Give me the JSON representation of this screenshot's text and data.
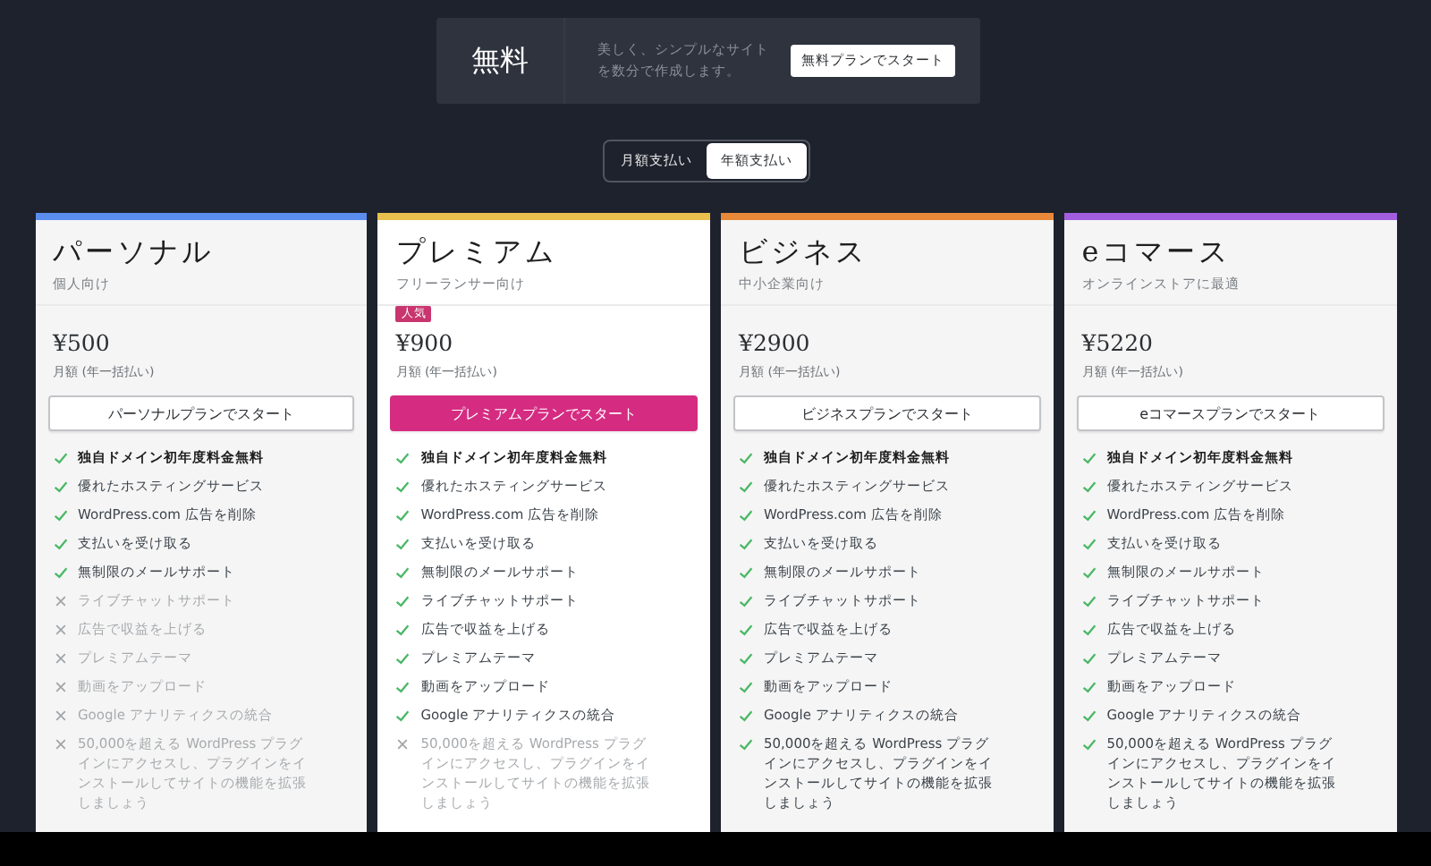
{
  "free_plan": {
    "title": "無料",
    "description": "美しく、シンプルなサイトを数分で作成します。",
    "button": "無料プランでスタート"
  },
  "billing_toggle": [
    {
      "label": "月額支払い",
      "selected": false
    },
    {
      "label": "年額支払い",
      "selected": true
    }
  ],
  "plans": [
    {
      "name": "パーソナル",
      "audience": "個人向け",
      "color": "#5b8def",
      "price": "¥500",
      "price_note": "月額 (年一括払い)",
      "button": "パーソナルプランでスタート",
      "highlighted": false,
      "features": [
        {
          "text": "独自ドメイン初年度料金無料",
          "included": true,
          "bold": true
        },
        {
          "text": "優れたホスティングサービス",
          "included": true,
          "bold": false
        },
        {
          "text": "WordPress.com 広告を削除",
          "included": true,
          "bold": false
        },
        {
          "text": "支払いを受け取る",
          "included": true,
          "bold": false
        },
        {
          "text": "無制限のメールサポート",
          "included": true,
          "bold": false
        },
        {
          "text": "ライブチャットサポート",
          "included": false,
          "bold": false
        },
        {
          "text": "広告で収益を上げる",
          "included": false,
          "bold": false
        },
        {
          "text": "プレミアムテーマ",
          "included": false,
          "bold": false
        },
        {
          "text": "動画をアップロード",
          "included": false,
          "bold": false
        },
        {
          "text": "Google アナリティクスの統合",
          "included": false,
          "bold": false
        },
        {
          "text": "50,000を超える WordPress プラグインにアクセスし、プラグインをインストールしてサイトの機能を拡張しましょう",
          "included": false,
          "bold": false
        }
      ]
    },
    {
      "name": "プレミアム",
      "audience": "フリーランサー向け",
      "badge": "人気",
      "color": "#e9c04d",
      "price": "¥900",
      "price_note": "月額 (年一括払い)",
      "button": "プレミアムプランでスタート",
      "highlighted": true,
      "features": [
        {
          "text": "独自ドメイン初年度料金無料",
          "included": true,
          "bold": true
        },
        {
          "text": "優れたホスティングサービス",
          "included": true,
          "bold": false
        },
        {
          "text": "WordPress.com 広告を削除",
          "included": true,
          "bold": false
        },
        {
          "text": "支払いを受け取る",
          "included": true,
          "bold": false
        },
        {
          "text": "無制限のメールサポート",
          "included": true,
          "bold": false
        },
        {
          "text": "ライブチャットサポート",
          "included": true,
          "bold": false
        },
        {
          "text": "広告で収益を上げる",
          "included": true,
          "bold": false
        },
        {
          "text": "プレミアムテーマ",
          "included": true,
          "bold": false
        },
        {
          "text": "動画をアップロード",
          "included": true,
          "bold": false
        },
        {
          "text": "Google アナリティクスの統合",
          "included": true,
          "bold": false
        },
        {
          "text": "50,000を超える WordPress プラグインにアクセスし、プラグインをインストールしてサイトの機能を拡張しましょう",
          "included": false,
          "bold": false
        }
      ]
    },
    {
      "name": "ビジネス",
      "audience": "中小企業向け",
      "color": "#e8893a",
      "price": "¥2900",
      "price_note": "月額 (年一括払い)",
      "button": "ビジネスプランでスタート",
      "highlighted": false,
      "features": [
        {
          "text": "独自ドメイン初年度料金無料",
          "included": true,
          "bold": true
        },
        {
          "text": "優れたホスティングサービス",
          "included": true,
          "bold": false
        },
        {
          "text": "WordPress.com 広告を削除",
          "included": true,
          "bold": false
        },
        {
          "text": "支払いを受け取る",
          "included": true,
          "bold": false
        },
        {
          "text": "無制限のメールサポート",
          "included": true,
          "bold": false
        },
        {
          "text": "ライブチャットサポート",
          "included": true,
          "bold": false
        },
        {
          "text": "広告で収益を上げる",
          "included": true,
          "bold": false
        },
        {
          "text": "プレミアムテーマ",
          "included": true,
          "bold": false
        },
        {
          "text": "動画をアップロード",
          "included": true,
          "bold": false
        },
        {
          "text": "Google アナリティクスの統合",
          "included": true,
          "bold": false
        },
        {
          "text": "50,000を超える WordPress プラグインにアクセスし、プラグインをインストールしてサイトの機能を拡張しましょう",
          "included": true,
          "bold": false
        }
      ]
    },
    {
      "name": "eコマース",
      "audience": "オンラインストアに最適",
      "color": "#a35ee0",
      "price": "¥5220",
      "price_note": "月額 (年一括払い)",
      "button": "eコマースプランでスタート",
      "highlighted": false,
      "features": [
        {
          "text": "独自ドメイン初年度料金無料",
          "included": true,
          "bold": true
        },
        {
          "text": "優れたホスティングサービス",
          "included": true,
          "bold": false
        },
        {
          "text": "WordPress.com 広告を削除",
          "included": true,
          "bold": false
        },
        {
          "text": "支払いを受け取る",
          "included": true,
          "bold": false
        },
        {
          "text": "無制限のメールサポート",
          "included": true,
          "bold": false
        },
        {
          "text": "ライブチャットサポート",
          "included": true,
          "bold": false
        },
        {
          "text": "広告で収益を上げる",
          "included": true,
          "bold": false
        },
        {
          "text": "プレミアムテーマ",
          "included": true,
          "bold": false
        },
        {
          "text": "動画をアップロード",
          "included": true,
          "bold": false
        },
        {
          "text": "Google アナリティクスの統合",
          "included": true,
          "bold": false
        },
        {
          "text": "50,000を超える WordPress プラグインにアクセスし、プラグインをインストールしてサイトの機能を拡張しましょう",
          "included": true,
          "bold": false
        }
      ]
    }
  ]
}
